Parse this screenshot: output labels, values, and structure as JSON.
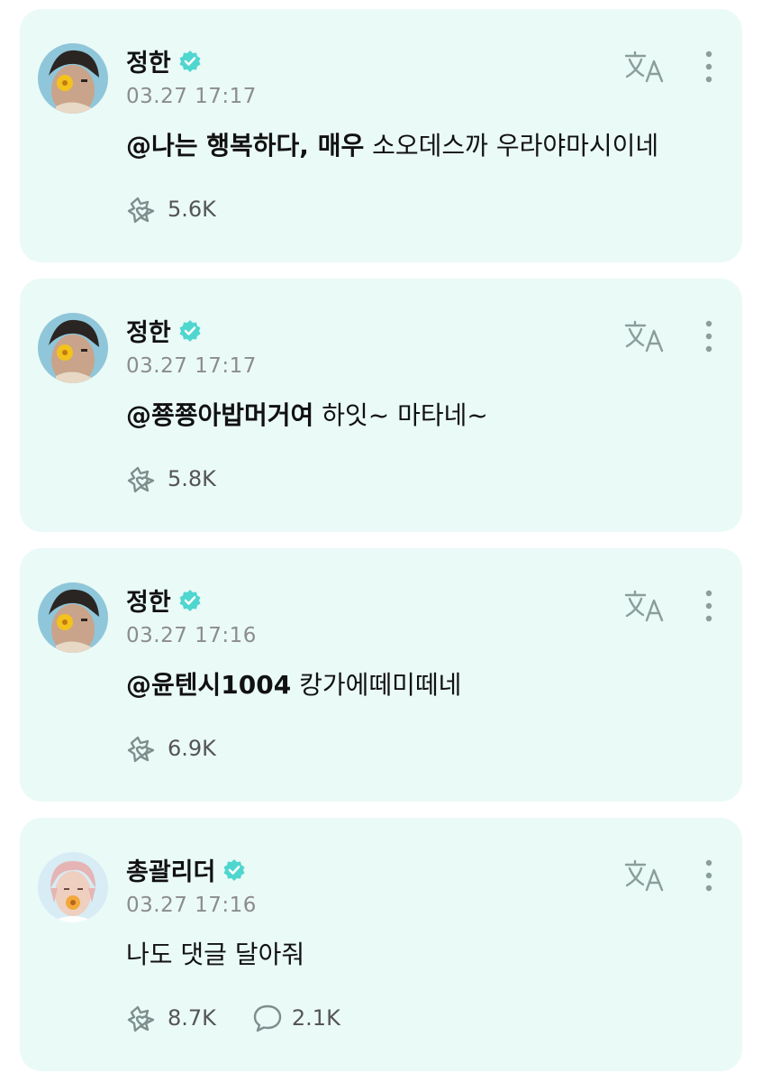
{
  "posts": [
    {
      "author": "정한",
      "time": "03.27 17:17",
      "mention": "@나는 행복하다, 매우",
      "text": " 소오데스까 우라야마시이네",
      "likes": "5.6K",
      "comments": ""
    },
    {
      "author": "정한",
      "time": "03.27 17:17",
      "mention": "@쭁쭁아밥머거여",
      "text": " 하잇~ 마타네~",
      "likes": "5.8K",
      "comments": ""
    },
    {
      "author": "정한",
      "time": "03.27 17:16",
      "mention": "@윤텐시1004",
      "text": " 캉가에떼미떼네",
      "likes": "6.9K",
      "comments": ""
    },
    {
      "author": "총괄리더",
      "time": "03.27 17:16",
      "mention": "",
      "text": "나도 댓글 달아줘",
      "likes": "8.7K",
      "comments": "2.1K"
    }
  ],
  "icons": {
    "verified": "verified-badge-icon",
    "translate": "translate-icon",
    "more": "more-vertical-icon",
    "like": "like-icon",
    "comment": "comment-icon"
  },
  "colors": {
    "card_bg": "#eafaf7",
    "accent": "#4fd6cf",
    "muted": "#8c8c8c"
  }
}
